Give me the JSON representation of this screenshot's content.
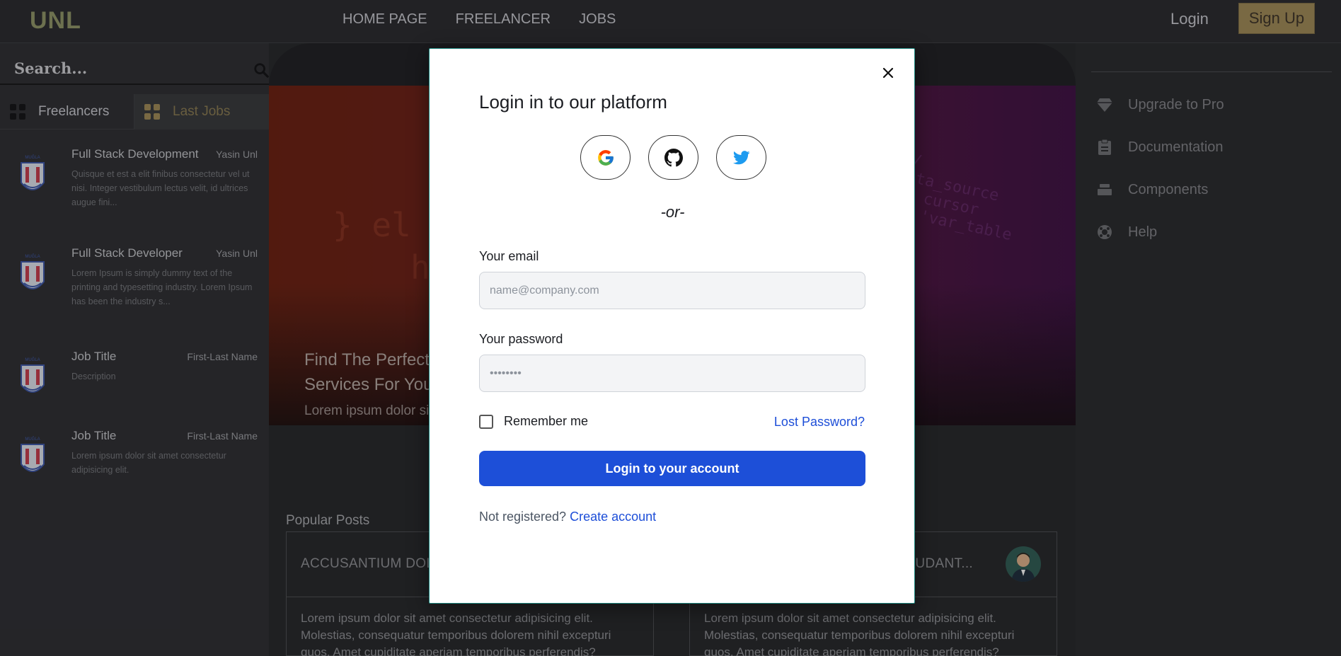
{
  "nav": {
    "logo": "UNL",
    "links": [
      "HOME PAGE",
      "FREELANCER",
      "JOBS"
    ],
    "login": "Login",
    "signup": "Sign Up"
  },
  "sidebar": {
    "search_placeholder": "Search...",
    "tabs": [
      "Freelancers",
      "Last Jobs"
    ],
    "jobs": [
      {
        "title": "Full Stack Development",
        "author": "Yasin Unl",
        "desc": "Quisque et est a elit finibus consectetur vel ut nisi. Integer vestibulum lectus velit, id ultrices augue fini..."
      },
      {
        "title": "Full Stack Developer",
        "author": "Yasin Unl",
        "desc": "Lorem Ipsum is simply dummy text of the printing and typesetting industry. Lorem Ipsum has been the industry s..."
      },
      {
        "title": "Job Title",
        "author": "First-Last Name",
        "desc": "Description"
      },
      {
        "title": "Job Title",
        "author": "First-Last Name",
        "desc": "Lorem ipsum dolor sit amet consectetur adipisicing elit."
      }
    ]
  },
  "hero": {
    "title": "Find The Perfect Services For You",
    "subtitle": "Lorem ipsum dolor sit quidem? Numquam"
  },
  "posts": {
    "heading": "Popular Posts",
    "cards": [
      {
        "title": "ACCUSANTIUM DOL",
        "body": "Lorem ipsum dolor sit amet consectetur adipisicing elit. Molestias, consequatur temporibus dolorem nihil excepturi quos. Amet cupiditate aperiam temporibus perferendis?"
      },
      {
        "title": "AUDANT...",
        "body": "Lorem ipsum dolor sit amet consectetur adipisicing elit. Molestias, consequatur temporibus dolorem nihil excepturi quos. Amet cupiditate aperiam temporibus perferendis?"
      }
    ]
  },
  "right_menu": [
    {
      "label": "Upgrade to Pro",
      "icon": "diamond-icon"
    },
    {
      "label": "Documentation",
      "icon": "clipboard-icon"
    },
    {
      "label": "Components",
      "icon": "stack-icon"
    },
    {
      "label": "Help",
      "icon": "lifebuoy-icon"
    }
  ],
  "modal": {
    "title": "Login in to our platform",
    "social": [
      "google-icon",
      "github-icon",
      "twitter-icon"
    ],
    "or_text": "-or-",
    "email_label": "Your email",
    "email_placeholder": "name@company.com",
    "password_label": "Your password",
    "password_placeholder": "••••••••",
    "remember": "Remember me",
    "lost_password": "Lost Password?",
    "submit": "Login to your account",
    "not_registered": "Not registered?",
    "create_account": "Create account"
  },
  "colors": {
    "primary": "#1d4fd8",
    "modal_border": "#1f8a82",
    "signup_bg": "#a08a55"
  }
}
